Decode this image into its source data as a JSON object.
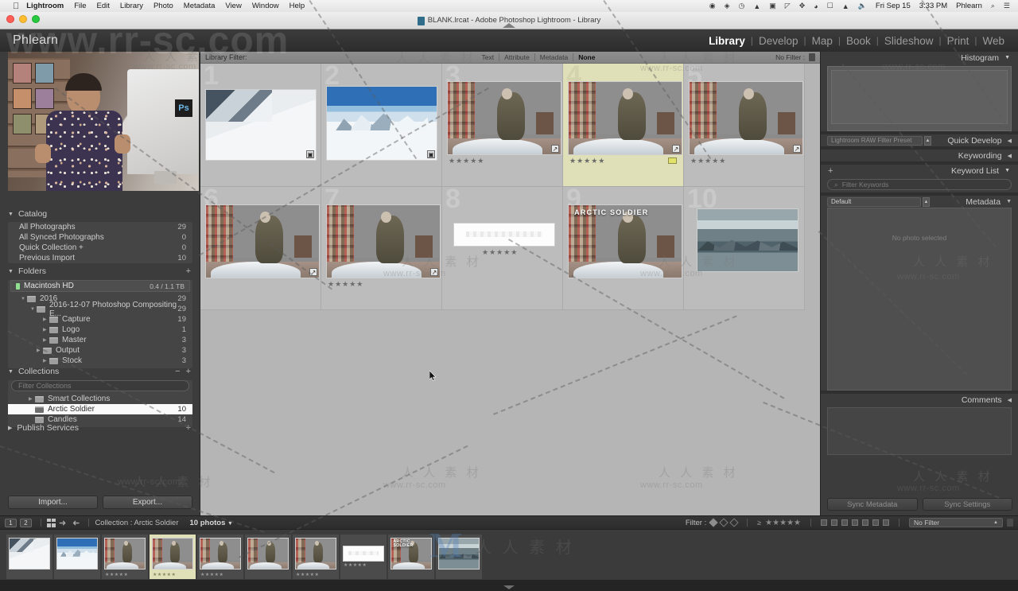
{
  "os_menubar": {
    "apple_icon": "apple-icon",
    "items": [
      "Lightroom",
      "File",
      "Edit",
      "Library",
      "Photo",
      "Metadata",
      "View",
      "Window",
      "Help"
    ],
    "status_icons": [
      "record-icon",
      "dropbox-icon",
      "clock-icon",
      "activity-icon",
      "screens-icon",
      "timemachine-icon",
      "bluetooth-icon",
      "wifi-icon",
      "airplay-icon",
      "eject-icon",
      "volume-icon"
    ],
    "date": "Fri Sep 15",
    "time": "3:33 PM",
    "user": "Phlearn",
    "search_icon": "search-icon",
    "menu_icon": "control-center-icon"
  },
  "window": {
    "title": "BLANK.lrcat - Adobe Photoshop Lightroom - Library",
    "doc_icon": "lrcat-file-icon"
  },
  "topbar": {
    "identity_plate": "Phlearn",
    "modules": [
      {
        "label": "Library",
        "active": true
      },
      {
        "label": "Develop",
        "active": false
      },
      {
        "label": "Map",
        "active": false
      },
      {
        "label": "Book",
        "active": false
      },
      {
        "label": "Slideshow",
        "active": false
      },
      {
        "label": "Print",
        "active": false
      },
      {
        "label": "Web",
        "active": false
      }
    ]
  },
  "left_panel": {
    "catalog": {
      "title": "Catalog",
      "items": [
        {
          "label": "All Photographs",
          "count": "29"
        },
        {
          "label": "All Synced Photographs",
          "count": "0"
        },
        {
          "label": "Quick Collection  +",
          "count": "0"
        },
        {
          "label": "Previous Import",
          "count": "10"
        }
      ]
    },
    "folders": {
      "title": "Folders",
      "volume": {
        "label": "Macintosh HD",
        "capacity": "0.4 / 1.1 TB"
      },
      "items": [
        {
          "label": "2016",
          "count": "29",
          "indent": 0,
          "expanded": true
        },
        {
          "label": "2016-12-07 Photoshop Compositing E...",
          "count": "29",
          "indent": 1,
          "expanded": true
        },
        {
          "label": "Capture",
          "count": "19",
          "indent": 2,
          "expanded": false
        },
        {
          "label": "Logo",
          "count": "1",
          "indent": 2,
          "expanded": false
        },
        {
          "label": "Master",
          "count": "3",
          "indent": 2,
          "expanded": false
        },
        {
          "label": "Output",
          "count": "3",
          "indent": 2,
          "expanded": false
        },
        {
          "label": "Stock",
          "count": "3",
          "indent": 2,
          "expanded": false
        }
      ]
    },
    "collections": {
      "title": "Collections",
      "search_placeholder": "Filter Collections",
      "items": [
        {
          "label": "Smart Collections",
          "count": "",
          "selected": false
        },
        {
          "label": "Arctic Soldier",
          "count": "10",
          "selected": true
        },
        {
          "label": "Candles",
          "count": "14",
          "selected": false
        }
      ]
    },
    "publish_services": {
      "title": "Publish Services"
    },
    "import_label": "Import...",
    "export_label": "Export..."
  },
  "library_filter": {
    "label": "Library Filter:",
    "tabs": [
      {
        "label": "Text",
        "active": false
      },
      {
        "label": "Attribute",
        "active": false
      },
      {
        "label": "Metadata",
        "active": false
      },
      {
        "label": "None",
        "active": true
      }
    ],
    "right_label": "No Filter  :",
    "lock_icon": "lock-icon"
  },
  "grid": {
    "cells": [
      {
        "num": "1",
        "stars": "",
        "badge": "crop-badge",
        "color_label": false,
        "art": "snow1",
        "title": ""
      },
      {
        "num": "2",
        "stars": "",
        "badge": "crop-badge",
        "color_label": false,
        "art": "snow2",
        "title": ""
      },
      {
        "num": "3",
        "stars": "★★★★★",
        "badge": "edit-badge",
        "color_label": false,
        "art": "soldier",
        "title": ""
      },
      {
        "num": "4",
        "stars": "★★★★★",
        "badge": "edit-badge",
        "color_label": true,
        "art": "soldier",
        "title": ""
      },
      {
        "num": "5",
        "stars": "★★★★★",
        "badge": "edit-badge",
        "color_label": false,
        "art": "soldier",
        "title": ""
      },
      {
        "num": "6",
        "stars": "",
        "badge": "edit-badge",
        "color_label": false,
        "art": "soldier-smoke",
        "title": ""
      },
      {
        "num": "7",
        "stars": "★★★★★",
        "badge": "edit-badge",
        "color_label": false,
        "art": "soldier",
        "title": ""
      },
      {
        "num": "8",
        "stars": "★★★★★",
        "badge": "",
        "color_label": false,
        "art": "logo",
        "title": ""
      },
      {
        "num": "9",
        "stars": "",
        "badge": "",
        "color_label": false,
        "art": "soldier",
        "title": "ARCTIC\nSOLDIER"
      },
      {
        "num": "10",
        "stars": "",
        "badge": "",
        "color_label": false,
        "art": "lake",
        "title": ""
      }
    ]
  },
  "right_panel": {
    "histogram": {
      "title": "Histogram"
    },
    "quick_develop": {
      "title": "Quick Develop",
      "preset": "Lightroom RAW Filter Preset"
    },
    "keywording": {
      "title": "Keywording"
    },
    "keyword_list": {
      "title": "Keyword List",
      "search_placeholder": "Filter Keywords"
    },
    "metadata": {
      "title": "Metadata",
      "preset": "Default",
      "empty_text": "No photo selected"
    },
    "comments": {
      "title": "Comments"
    },
    "sync_metadata_label": "Sync Metadata",
    "sync_settings_label": "Sync Settings"
  },
  "toolbar": {
    "view_1": "1",
    "view_2": "2",
    "grid_icon": "grid-view-icon",
    "back_icon": "back-arrow-icon",
    "forward_icon": "forward-arrow-icon",
    "source_label": "Collection : Arctic Soldier",
    "photo_count": "10 photos",
    "filter_label": "Filter :",
    "rating_op": "≥",
    "stars": "★★★★★",
    "no_filter": "No Filter"
  },
  "filmstrip": {
    "thumbs": [
      {
        "art": "snow1",
        "stars": "",
        "selected": false
      },
      {
        "art": "snow2",
        "stars": "",
        "selected": false
      },
      {
        "art": "soldier",
        "stars": "★★★★★",
        "selected": false
      },
      {
        "art": "soldier",
        "stars": "★★★★★",
        "selected": true
      },
      {
        "art": "soldier",
        "stars": "★★★★★",
        "selected": false
      },
      {
        "art": "soldier-smoke",
        "stars": "",
        "selected": false
      },
      {
        "art": "soldier",
        "stars": "★★★★★",
        "selected": false
      },
      {
        "art": "logo",
        "stars": "★★★★★",
        "selected": false
      },
      {
        "art": "soldier",
        "stars": "",
        "selected": false
      },
      {
        "art": "lake",
        "stars": "",
        "selected": false
      }
    ]
  },
  "watermarks": {
    "url": "www.rr-sc.com",
    "cn": "人 人 素 材"
  }
}
